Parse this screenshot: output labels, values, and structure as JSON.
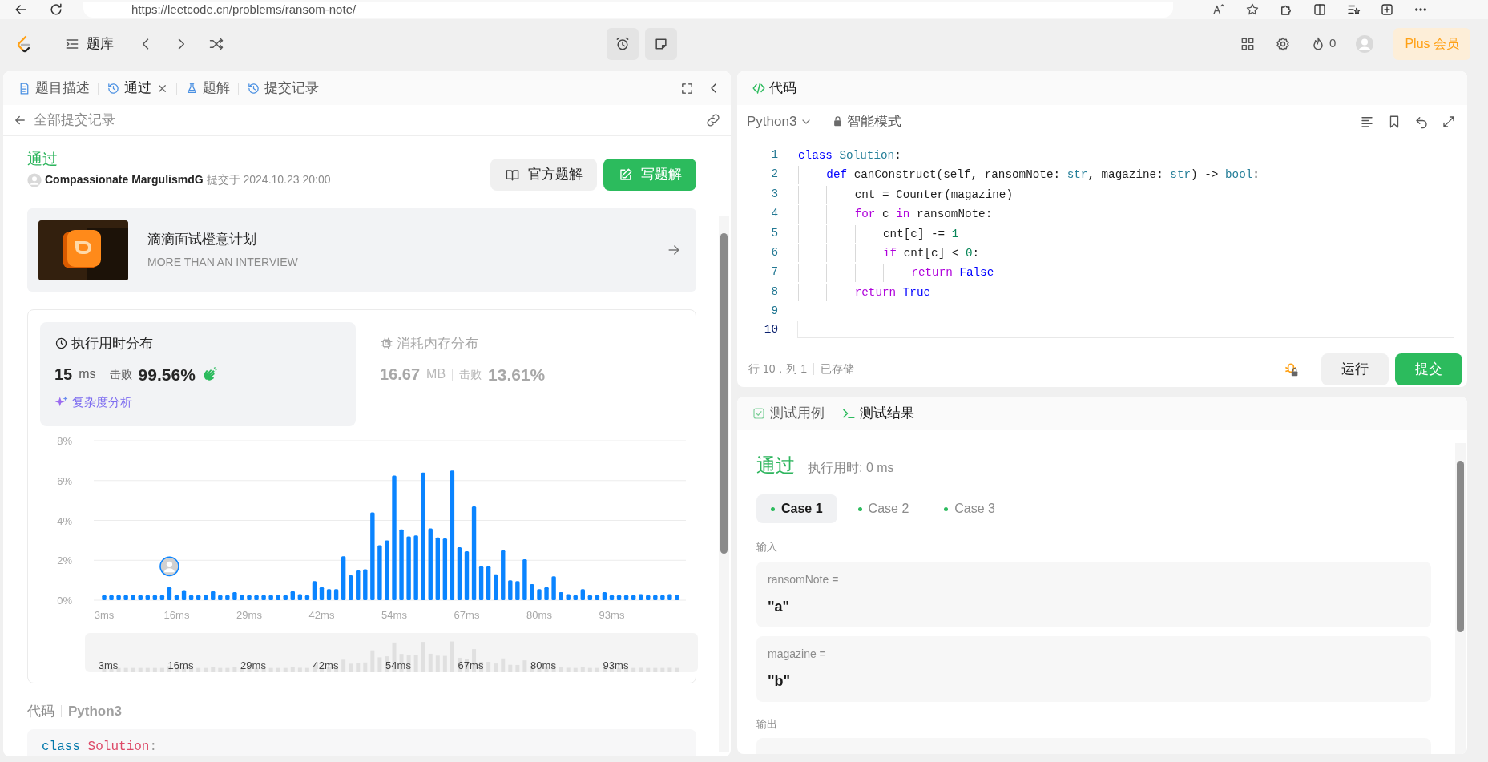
{
  "browser": {
    "address": "https://leetcode.cn/problems/ransom-note/"
  },
  "header": {
    "nav_label": "题库",
    "streak": "0",
    "plus_button": "Plus 会员"
  },
  "left_panel": {
    "tabs": [
      {
        "label": "题目描述",
        "kind": "doc",
        "selected": false,
        "closable": false
      },
      {
        "label": "通过",
        "kind": "history",
        "selected": true,
        "closable": true
      },
      {
        "label": "题解",
        "kind": "flask",
        "selected": false,
        "closable": false
      },
      {
        "label": "提交记录",
        "kind": "history",
        "selected": false,
        "closable": false
      }
    ],
    "back_link": "全部提交记录",
    "submission": {
      "status": "通过",
      "user": "Compassionate MargulismdG",
      "submitted": "提交于 2024.10.23 20:00",
      "buttons": [
        {
          "label": "官方题解",
          "kind": "secondary"
        },
        {
          "label": "写题解",
          "kind": "primary"
        }
      ]
    },
    "promo": {
      "title": "滴滴面试橙意计划",
      "subtitle": "MORE THAN AN INTERVIEW"
    },
    "stats": {
      "tabs": [
        {
          "title": "执行用时分布",
          "kind": "runtime",
          "selected": true,
          "value": "15",
          "unit": "ms",
          "beats_label": "击败",
          "beats": "99.56%"
        },
        {
          "title": "消耗内存分布",
          "kind": "memory",
          "selected": false,
          "value": "16.67",
          "unit": "MB",
          "beats_label": "击败",
          "beats": "13.61%"
        }
      ],
      "analysis_link": "复杂度分析",
      "chart_data": {
        "type": "bar",
        "ylim": [
          0,
          8
        ],
        "grid": true,
        "yticks": [
          {
            "value": 0,
            "label": "0%"
          },
          {
            "value": 2,
            "label": "2%"
          },
          {
            "value": 4,
            "label": "4%"
          },
          {
            "value": 6,
            "label": "6%"
          },
          {
            "value": 8,
            "label": "8%"
          }
        ],
        "categories": [
          "3ms",
          null,
          null,
          null,
          null,
          null,
          null,
          null,
          null,
          null,
          "16ms",
          null,
          null,
          null,
          null,
          null,
          null,
          null,
          null,
          null,
          "29ms",
          null,
          null,
          null,
          null,
          null,
          null,
          null,
          null,
          null,
          "42ms",
          null,
          null,
          null,
          null,
          null,
          null,
          null,
          null,
          null,
          "54ms",
          null,
          null,
          null,
          null,
          null,
          null,
          null,
          null,
          null,
          "67ms",
          null,
          null,
          null,
          null,
          null,
          null,
          null,
          null,
          null,
          "80ms",
          null,
          null,
          null,
          null,
          null,
          null,
          null,
          null,
          null,
          "93ms",
          null,
          null,
          null,
          null,
          null,
          null,
          null,
          null,
          null
        ],
        "values": [
          0.25,
          0.25,
          0.25,
          0.25,
          0.25,
          0.25,
          0.25,
          0.25,
          0.25,
          0.65,
          0.25,
          0.5,
          0.25,
          0.25,
          0.25,
          0.45,
          0.25,
          0.25,
          0.4,
          0.25,
          0.25,
          0.25,
          0.25,
          0.25,
          0.25,
          0.25,
          0.45,
          0.3,
          0.25,
          0.95,
          0.65,
          0.55,
          0.55,
          2.2,
          1.25,
          1.5,
          1.55,
          4.4,
          2.75,
          3.0,
          6.25,
          3.55,
          3.2,
          3.25,
          6.4,
          3.6,
          3.15,
          3.1,
          6.5,
          2.65,
          2.45,
          4.7,
          1.7,
          1.7,
          1.3,
          2.5,
          1.0,
          0.95,
          2.05,
          0.8,
          0.55,
          0.65,
          1.2,
          0.4,
          0.3,
          0.25,
          0.55,
          0.25,
          0.25,
          0.4,
          0.25,
          0.25,
          0.25,
          0.25,
          0.3,
          0.25,
          0.25,
          0.25,
          0.3,
          0.25
        ]
      },
      "navigator": {
        "labels": [
          "3ms",
          "16ms",
          "29ms",
          "42ms",
          "54ms",
          "67ms",
          "80ms",
          "93ms"
        ]
      }
    },
    "code_header": {
      "label": "代码",
      "language": "Python3"
    },
    "code_preview": [
      [
        {
          "text": "class",
          "kind": "keyword"
        },
        {
          "text": " Solution",
          "kind": "class-name"
        },
        {
          "text": ":",
          "kind": "punct"
        }
      ]
    ]
  },
  "editor": {
    "title": "代码",
    "language": "Python3",
    "mode": "智能模式",
    "lines": [
      {
        "number": "1",
        "active": false,
        "tokens": [
          {
            "text": "class",
            "kind": "kw"
          },
          {
            "text": " Solution",
            "kind": "type"
          },
          {
            "text": ":",
            "kind": "plain"
          }
        ]
      },
      {
        "number": "2",
        "active": false,
        "tokens": [
          {
            "text": "    def",
            "kind": "kw"
          },
          {
            "text": " canConstruct(self, ransomNote: ",
            "kind": "plain"
          },
          {
            "text": "str",
            "kind": "type"
          },
          {
            "text": ", magazine: ",
            "kind": "plain"
          },
          {
            "text": "str",
            "kind": "type"
          },
          {
            "text": ") -> ",
            "kind": "plain"
          },
          {
            "text": "bool",
            "kind": "type"
          },
          {
            "text": ":",
            "kind": "plain"
          }
        ]
      },
      {
        "number": "3",
        "active": false,
        "tokens": [
          {
            "text": "        cnt = Counter(magazine)",
            "kind": "plain"
          }
        ]
      },
      {
        "number": "4",
        "active": false,
        "tokens": [
          {
            "text": "        for",
            "kind": "ctl"
          },
          {
            "text": " c ",
            "kind": "plain"
          },
          {
            "text": "in",
            "kind": "ctl"
          },
          {
            "text": " ransomNote:",
            "kind": "plain"
          }
        ]
      },
      {
        "number": "5",
        "active": false,
        "tokens": [
          {
            "text": "            cnt[c] -= ",
            "kind": "plain"
          },
          {
            "text": "1",
            "kind": "num"
          }
        ]
      },
      {
        "number": "6",
        "active": false,
        "tokens": [
          {
            "text": "            if",
            "kind": "ctl"
          },
          {
            "text": " cnt[c] < ",
            "kind": "plain"
          },
          {
            "text": "0",
            "kind": "num"
          },
          {
            "text": ":",
            "kind": "plain"
          }
        ]
      },
      {
        "number": "7",
        "active": false,
        "tokens": [
          {
            "text": "                return",
            "kind": "ctl"
          },
          {
            "text": " False",
            "kind": "kw"
          }
        ]
      },
      {
        "number": "8",
        "active": false,
        "tokens": [
          {
            "text": "        return",
            "kind": "ctl"
          },
          {
            "text": " True",
            "kind": "kw"
          }
        ]
      },
      {
        "number": "9",
        "active": false
      },
      {
        "number": "10",
        "active": true
      }
    ],
    "position": "行 10，列 1",
    "saved": "已存储",
    "buttons": [
      {
        "label": "运行",
        "kind": "secondary"
      },
      {
        "label": "提交",
        "kind": "primary"
      }
    ]
  },
  "console": {
    "tabs": [
      {
        "label": "测试用例",
        "kind": "testcase",
        "selected": false
      },
      {
        "label": "测试结果",
        "kind": "result",
        "selected": true
      }
    ],
    "status": "通过",
    "runtime": "执行用时: 0 ms",
    "cases": [
      {
        "label": "Case 1",
        "selected": true
      },
      {
        "label": "Case 2",
        "selected": false
      },
      {
        "label": "Case 3",
        "selected": false
      }
    ],
    "input_label": "输入",
    "inputs": [
      {
        "name": "ransomNote =",
        "value": "\"a\""
      },
      {
        "name": "magazine =",
        "value": "\"b\""
      }
    ],
    "output_label": "输出"
  }
}
